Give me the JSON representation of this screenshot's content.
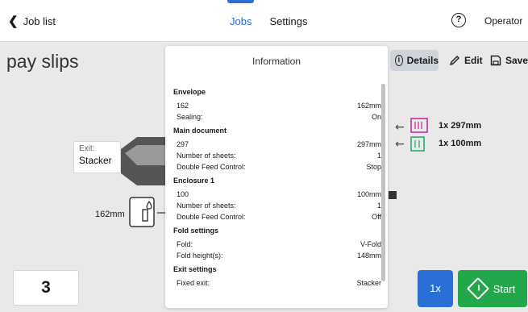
{
  "header": {
    "back_label": "Job list",
    "tabs": [
      {
        "label": "Jobs",
        "active": true
      },
      {
        "label": "Settings",
        "active": false
      }
    ],
    "help_glyph": "?",
    "user_label": "Operator"
  },
  "job": {
    "name": "pay slips"
  },
  "toolbar": {
    "details_label": "Details",
    "details_glyph": "i",
    "edit_label": "Edit",
    "save_label": "Save"
  },
  "machine": {
    "exit_label": "Exit:",
    "exit_value": "Stacker",
    "envelope_size": "162mm",
    "feeders": [
      {
        "label": "1x 297mm",
        "color": "#c0249c"
      },
      {
        "label": "1x 100mm",
        "color": "#1aa86b"
      }
    ]
  },
  "info": {
    "title": "Information",
    "sections": {
      "envelope": {
        "title": "Envelope",
        "rows": [
          {
            "label": "162",
            "value": "162mm"
          },
          {
            "label": "Sealing:",
            "value": "On"
          }
        ]
      },
      "main_document": {
        "title": "Main document",
        "rows": [
          {
            "label": "297",
            "value": "297mm"
          },
          {
            "label": "Number of sheets:",
            "value": "1"
          },
          {
            "label": "Double Feed Control:",
            "value": "Stop"
          }
        ]
      },
      "enclosure_1": {
        "title": "Enclosure 1",
        "rows": [
          {
            "label": "100",
            "value": "100mm"
          },
          {
            "label": "Number of sheets:",
            "value": "1"
          },
          {
            "label": "Double Feed Control:",
            "value": "Off"
          }
        ]
      },
      "fold_settings": {
        "title": "Fold settings",
        "rows": [
          {
            "label": "Fold:",
            "value": "V-Fold"
          },
          {
            "label": "Fold height(s):",
            "value": "148mm"
          }
        ]
      },
      "exit_settings": {
        "title": "Exit settings",
        "rows": [
          {
            "label": "Fixed exit:",
            "value": "Stacker"
          }
        ]
      }
    }
  },
  "footer": {
    "counter_value": "3",
    "quantity_label": "1x",
    "start_label": "Start"
  },
  "colors": {
    "accent_blue": "#2a6fd6",
    "start_green": "#22a84a"
  }
}
